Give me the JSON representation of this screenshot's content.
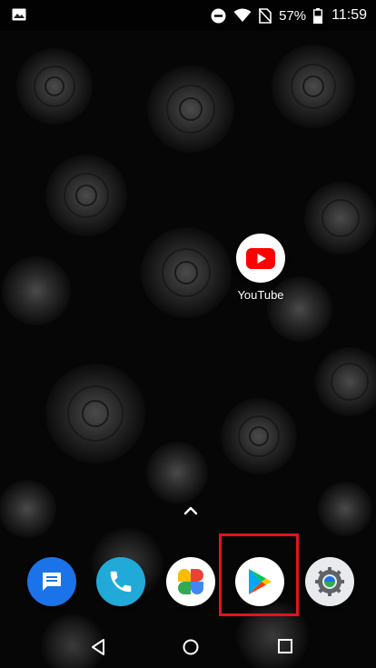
{
  "status_bar": {
    "battery_percent": "57%",
    "time": "11:59"
  },
  "home": {
    "apps": [
      {
        "name": "YouTube",
        "label": "YouTube"
      }
    ],
    "dock": [
      {
        "name": "messages",
        "icon": "messages-icon"
      },
      {
        "name": "phone",
        "icon": "phone-icon"
      },
      {
        "name": "photos",
        "icon": "photos-icon"
      },
      {
        "name": "play-store",
        "icon": "play-store-icon",
        "highlighted": true
      },
      {
        "name": "settings",
        "icon": "settings-icon"
      }
    ]
  },
  "colors": {
    "highlight": "#e0141e",
    "youtube_red": "#ff0000",
    "messages_blue": "#1a73e8",
    "phone_teal": "#21a9d8"
  }
}
